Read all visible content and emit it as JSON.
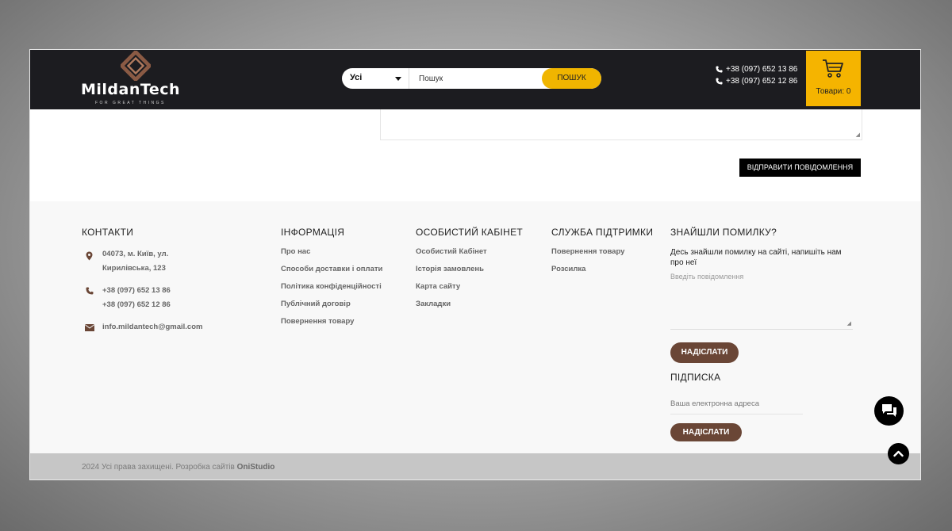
{
  "header": {
    "logo_text": "MildanTech",
    "logo_tagline": "FOR GREAT THINGS",
    "search": {
      "category": "Усі",
      "placeholder": "Пошук",
      "value": "Пошук",
      "button": "ПОШУК"
    },
    "phones": [
      "+38 (097) 652 13 86",
      "+38 (097) 652 12 86"
    ],
    "cart_label": "Товари: 0"
  },
  "form": {
    "send_button": "ВІДПРАВИТИ ПОВІДОМЛЕННЯ"
  },
  "footer": {
    "contacts": {
      "title": "КОНТАКТИ",
      "address_line1": "04073, м. Київ, ул.",
      "address_line2": "Кирилівська, 123",
      "phone1": "+38 (097) 652 13 86",
      "phone2": "+38 (097) 652 12 86",
      "email": "info.mildantech@gmail.com"
    },
    "info": {
      "title": "ІНФОРМАЦІЯ",
      "links": [
        "Про нас",
        "Способи доставки і оплати",
        "Політика конфіденційності",
        "Публічний договір",
        "Повернення товару"
      ]
    },
    "account": {
      "title": "ОСОБИСТИЙ КАБІНЕТ",
      "links": [
        "Особистий Кабінет",
        "Історія замовлень",
        "Карта сайту",
        "Закладки"
      ]
    },
    "support": {
      "title": "СЛУЖБА ПІДТРИМКИ",
      "links": [
        "Повернення товару",
        "Розсилка"
      ]
    },
    "error": {
      "title": "ЗНАЙШЛИ ПОМИЛКУ?",
      "text": "Десь знайшли помилку на сайті, напишіть нам про неї",
      "placeholder": "Введіть повідомлення",
      "button": "НАДІСЛАТИ"
    },
    "subscribe": {
      "title": "ПІДПИСКА",
      "placeholder": "Ваша електронна адреса",
      "button": "НАДІСЛАТИ"
    },
    "copyright_text": "2024 Усі права захищені. Розробка сайтів",
    "copyright_studio": "OniStudio"
  },
  "colors": {
    "header_bg": "#1c1c20",
    "accent_yellow": "#f5b400",
    "brown_button": "#6a4636"
  }
}
